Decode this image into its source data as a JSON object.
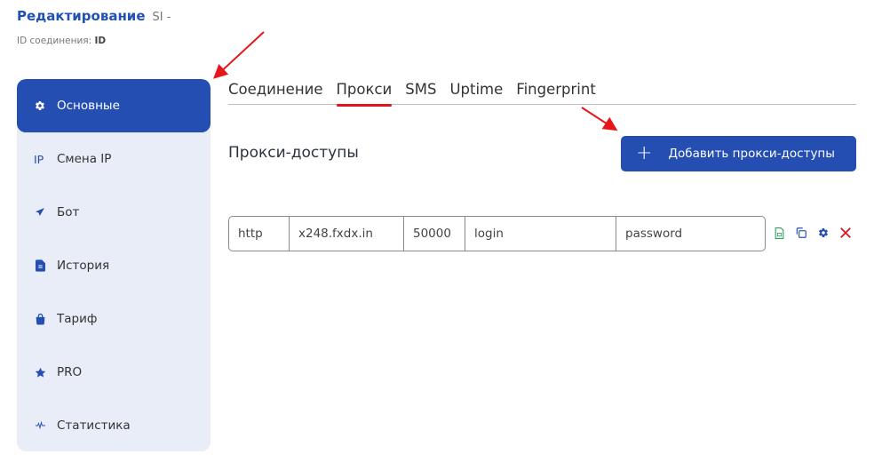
{
  "header": {
    "title": "Редактирование",
    "subtitle": "SI -",
    "connection_id_label": "ID соединения:",
    "connection_id_value": "ID"
  },
  "sidebar": {
    "items": [
      {
        "label": "Основные",
        "icon": "gear-icon",
        "active": true
      },
      {
        "label": "Смена IP",
        "icon": "ip-icon",
        "icon_text": "IP"
      },
      {
        "label": "Бот",
        "icon": "paper-plane-icon"
      },
      {
        "label": "История",
        "icon": "document-icon"
      },
      {
        "label": "Тариф",
        "icon": "shopping-bag-icon"
      },
      {
        "label": "PRO",
        "icon": "star-icon"
      },
      {
        "label": "Статистика",
        "icon": "pulse-icon"
      }
    ]
  },
  "tabs": [
    {
      "label": "Соединение"
    },
    {
      "label": "Прокси",
      "active": true
    },
    {
      "label": "SMS"
    },
    {
      "label": "Uptime"
    },
    {
      "label": "Fingerprint"
    }
  ],
  "section": {
    "title": "Прокси-доступы",
    "add_button_label": "Добавить прокси-доступы"
  },
  "proxy_row": {
    "protocol": "http",
    "host": "x248.fxdx.in",
    "port": "50000",
    "login": "login",
    "password": "password"
  },
  "colors": {
    "accent": "#244eb1",
    "sidebar_bg": "#e9edf8",
    "tab_underline": "#e0141b",
    "delete": "#e0141b",
    "export": "#2e9d5b"
  }
}
